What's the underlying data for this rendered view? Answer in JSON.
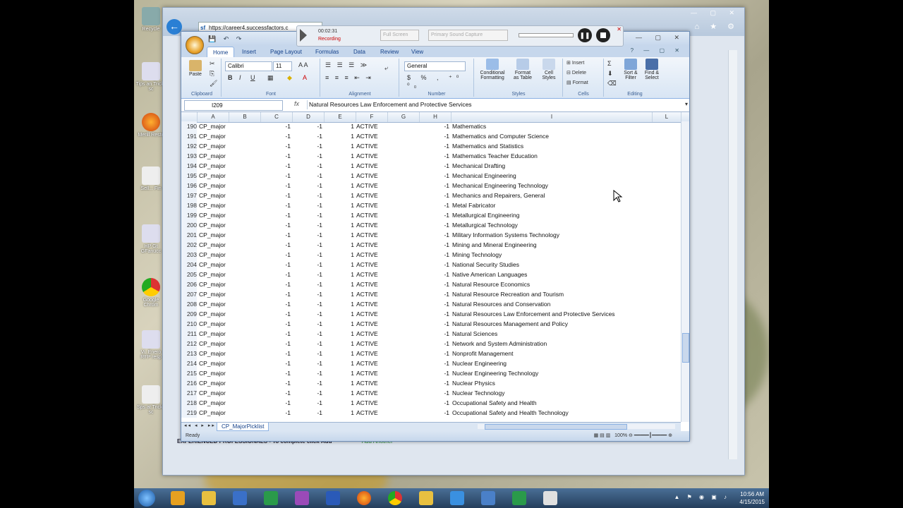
{
  "browser": {
    "url": "https://career4.successfactors.c",
    "url_icon": "sf",
    "page_text_bold": "EXPERIENCED PROFESSIONALS - To complete click",
    "page_text_add": "Add",
    "page_text_add_another": "Add Another"
  },
  "recorder": {
    "elapsed": "00:02:31",
    "status": "Recording",
    "screen_select": "Full Screen",
    "audio_select": "Primary Sound Capture"
  },
  "excel": {
    "tabs": [
      "Home",
      "Insert",
      "Page Layout",
      "Formulas",
      "Data",
      "Review",
      "View"
    ],
    "active_tab": "Home",
    "ribbon": {
      "paste": "Paste",
      "font_name": "Calibri",
      "font_size": "11",
      "number_format": "General",
      "conditional_formatting": "Conditional\nFormatting",
      "format_as_table": "Format\nas Table",
      "cell_styles": "Cell\nStyles",
      "insert": "Insert",
      "delete": "Delete",
      "format": "Format",
      "sort_filter": "Sort &\nFilter",
      "find_select": "Find &\nSelect",
      "groups": [
        "Clipboard",
        "Font",
        "Alignment",
        "Number",
        "Styles",
        "Cells",
        "Editing"
      ]
    },
    "name_box": "I209",
    "fx_label": "fx",
    "formula": "Natural Resources Law Enforcement and Protective Services",
    "columns": [
      "A",
      "B",
      "C",
      "D",
      "E",
      "F",
      "G",
      "H",
      "I",
      "L"
    ],
    "rows": [
      {
        "n": "190",
        "a": "CP_major",
        "c": "-1",
        "d": "-1",
        "e": "1",
        "f": "ACTIVE",
        "h": "-1",
        "i": "Mathematics"
      },
      {
        "n": "191",
        "a": "CP_major",
        "c": "-1",
        "d": "-1",
        "e": "1",
        "f": "ACTIVE",
        "h": "-1",
        "i": "Mathematics and Computer Science"
      },
      {
        "n": "192",
        "a": "CP_major",
        "c": "-1",
        "d": "-1",
        "e": "1",
        "f": "ACTIVE",
        "h": "-1",
        "i": "Mathematics and Statistics"
      },
      {
        "n": "193",
        "a": "CP_major",
        "c": "-1",
        "d": "-1",
        "e": "1",
        "f": "ACTIVE",
        "h": "-1",
        "i": "Mathematics Teacher Education"
      },
      {
        "n": "194",
        "a": "CP_major",
        "c": "-1",
        "d": "-1",
        "e": "1",
        "f": "ACTIVE",
        "h": "-1",
        "i": "Mechanical Drafting"
      },
      {
        "n": "195",
        "a": "CP_major",
        "c": "-1",
        "d": "-1",
        "e": "1",
        "f": "ACTIVE",
        "h": "-1",
        "i": "Mechanical Engineering"
      },
      {
        "n": "196",
        "a": "CP_major",
        "c": "-1",
        "d": "-1",
        "e": "1",
        "f": "ACTIVE",
        "h": "-1",
        "i": "Mechanical Engineering Technology"
      },
      {
        "n": "197",
        "a": "CP_major",
        "c": "-1",
        "d": "-1",
        "e": "1",
        "f": "ACTIVE",
        "h": "-1",
        "i": "Mechanics and Repairers, General"
      },
      {
        "n": "198",
        "a": "CP_major",
        "c": "-1",
        "d": "-1",
        "e": "1",
        "f": "ACTIVE",
        "h": "-1",
        "i": "Metal Fabricator"
      },
      {
        "n": "199",
        "a": "CP_major",
        "c": "-1",
        "d": "-1",
        "e": "1",
        "f": "ACTIVE",
        "h": "-1",
        "i": "Metallurgical Engineering"
      },
      {
        "n": "200",
        "a": "CP_major",
        "c": "-1",
        "d": "-1",
        "e": "1",
        "f": "ACTIVE",
        "h": "-1",
        "i": "Metallurgical Technology"
      },
      {
        "n": "201",
        "a": "CP_major",
        "c": "-1",
        "d": "-1",
        "e": "1",
        "f": "ACTIVE",
        "h": "-1",
        "i": "Military Information Systems Technology"
      },
      {
        "n": "202",
        "a": "CP_major",
        "c": "-1",
        "d": "-1",
        "e": "1",
        "f": "ACTIVE",
        "h": "-1",
        "i": "Mining and Mineral Engineering"
      },
      {
        "n": "203",
        "a": "CP_major",
        "c": "-1",
        "d": "-1",
        "e": "1",
        "f": "ACTIVE",
        "h": "-1",
        "i": "Mining Technology"
      },
      {
        "n": "204",
        "a": "CP_major",
        "c": "-1",
        "d": "-1",
        "e": "1",
        "f": "ACTIVE",
        "h": "-1",
        "i": "National Security Studies"
      },
      {
        "n": "205",
        "a": "CP_major",
        "c": "-1",
        "d": "-1",
        "e": "1",
        "f": "ACTIVE",
        "h": "-1",
        "i": "Native American Languages"
      },
      {
        "n": "206",
        "a": "CP_major",
        "c": "-1",
        "d": "-1",
        "e": "1",
        "f": "ACTIVE",
        "h": "-1",
        "i": "Natural Resource Economics"
      },
      {
        "n": "207",
        "a": "CP_major",
        "c": "-1",
        "d": "-1",
        "e": "1",
        "f": "ACTIVE",
        "h": "-1",
        "i": "Natural Resource Recreation and Tourism"
      },
      {
        "n": "208",
        "a": "CP_major",
        "c": "-1",
        "d": "-1",
        "e": "1",
        "f": "ACTIVE",
        "h": "-1",
        "i": "Natural Resources and Conservation"
      },
      {
        "n": "209",
        "a": "CP_major",
        "c": "-1",
        "d": "-1",
        "e": "1",
        "f": "ACTIVE",
        "h": "-1",
        "i": "Natural Resources Law Enforcement and Protective Services"
      },
      {
        "n": "210",
        "a": "CP_major",
        "c": "-1",
        "d": "-1",
        "e": "1",
        "f": "ACTIVE",
        "h": "-1",
        "i": "Natural Resources Management and Policy"
      },
      {
        "n": "211",
        "a": "CP_major",
        "c": "-1",
        "d": "-1",
        "e": "1",
        "f": "ACTIVE",
        "h": "-1",
        "i": "Natural Sciences"
      },
      {
        "n": "212",
        "a": "CP_major",
        "c": "-1",
        "d": "-1",
        "e": "1",
        "f": "ACTIVE",
        "h": "-1",
        "i": "Network and System Administration"
      },
      {
        "n": "213",
        "a": "CP_major",
        "c": "-1",
        "d": "-1",
        "e": "1",
        "f": "ACTIVE",
        "h": "-1",
        "i": "Nonprofit Management"
      },
      {
        "n": "214",
        "a": "CP_major",
        "c": "-1",
        "d": "-1",
        "e": "1",
        "f": "ACTIVE",
        "h": "-1",
        "i": "Nuclear Engineering"
      },
      {
        "n": "215",
        "a": "CP_major",
        "c": "-1",
        "d": "-1",
        "e": "1",
        "f": "ACTIVE",
        "h": "-1",
        "i": "Nuclear Engineering Technology"
      },
      {
        "n": "216",
        "a": "CP_major",
        "c": "-1",
        "d": "-1",
        "e": "1",
        "f": "ACTIVE",
        "h": "-1",
        "i": "Nuclear Physics"
      },
      {
        "n": "217",
        "a": "CP_major",
        "c": "-1",
        "d": "-1",
        "e": "1",
        "f": "ACTIVE",
        "h": "-1",
        "i": "Nuclear Technology"
      },
      {
        "n": "218",
        "a": "CP_major",
        "c": "-1",
        "d": "-1",
        "e": "1",
        "f": "ACTIVE",
        "h": "-1",
        "i": "Occupational Safety and Health"
      },
      {
        "n": "219",
        "a": "CP_major",
        "c": "-1",
        "d": "-1",
        "e": "1",
        "f": "ACTIVE",
        "h": "-1",
        "i": "Occupational Safety and Health Technology"
      }
    ],
    "sheet_tab": "CP_MajorPicklist",
    "status": "Ready",
    "zoom": "100%"
  },
  "desktop": {
    "icons": [
      "Recycle",
      "Tips an Tricks sc",
      "Merill Resto",
      "Sell... Fin",
      "HP Gt GFanucc",
      "Google Chrom",
      "Vi. Enero RFP resp",
      "Sps at Tricks sc"
    ]
  },
  "taskbar": {
    "time": "10:56 AM",
    "date": "4/15/2015"
  }
}
